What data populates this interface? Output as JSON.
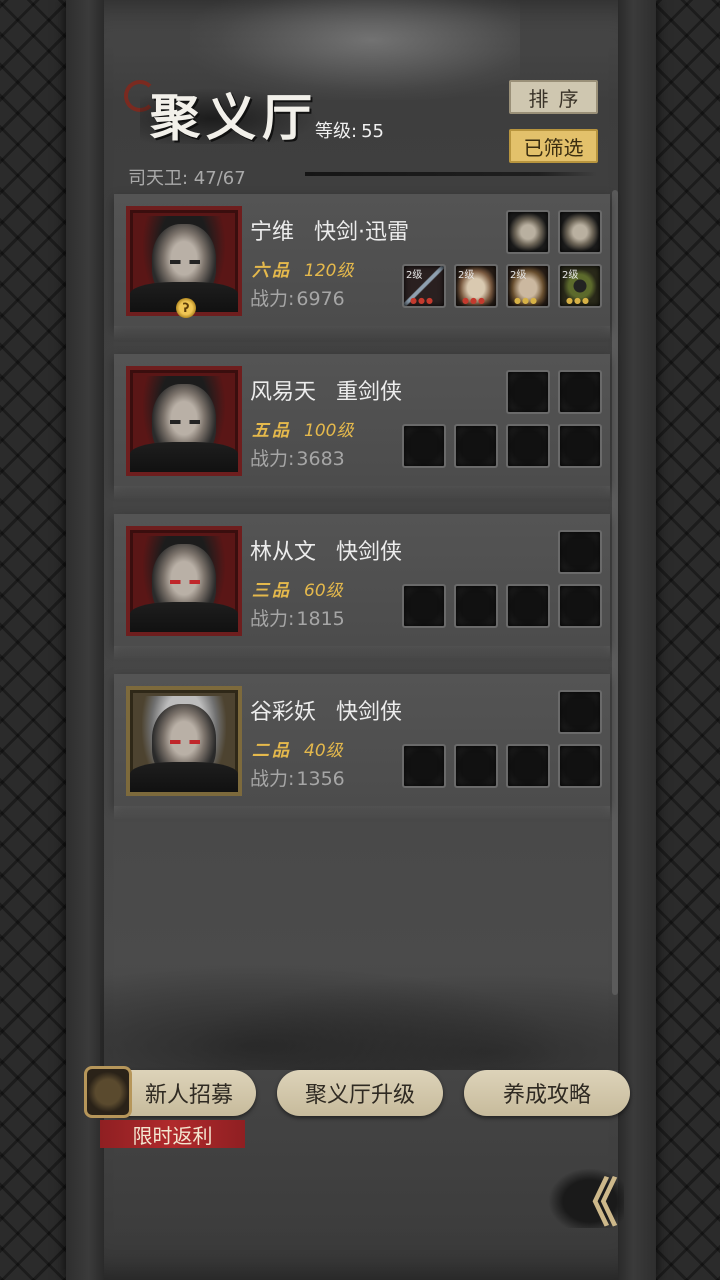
{
  "header": {
    "title": "聚义厅",
    "level_label": "等级:",
    "level_value": "55",
    "guard_count": "司天卫: 47/67",
    "sort_label": "排序",
    "filter_label": "已筛选"
  },
  "heroes": [
    {
      "name": "宁维",
      "class": "快剑·迅雷",
      "grade": "六品",
      "level": "120级",
      "power_label": "战力:",
      "power": "6976",
      "equipment_levels": [
        "2级",
        "2级",
        "2级",
        "2级"
      ]
    },
    {
      "name": "风易天",
      "class": "重剑侠",
      "grade": "五品",
      "level": "100级",
      "power_label": "战力:",
      "power": "3683"
    },
    {
      "name": "林从文",
      "class": "快剑侠",
      "grade": "三品",
      "level": "60级",
      "power_label": "战力:",
      "power": "1815"
    },
    {
      "name": "谷彩妖",
      "class": "快剑侠",
      "grade": "二品",
      "level": "40级",
      "power_label": "战力:",
      "power": "1356"
    }
  ],
  "bottom": {
    "recruit_label": "新人招募",
    "promo_label": "限时返利",
    "upgrade_label": "聚义厅升级",
    "guide_label": "养成攻略",
    "back_glyph": "《"
  },
  "colors": {
    "accent_gold": "#e3c16b",
    "rank_gold": "#e5b94c",
    "portrait_red": "#6e1e1e",
    "promo_red": "#b02a2c"
  }
}
